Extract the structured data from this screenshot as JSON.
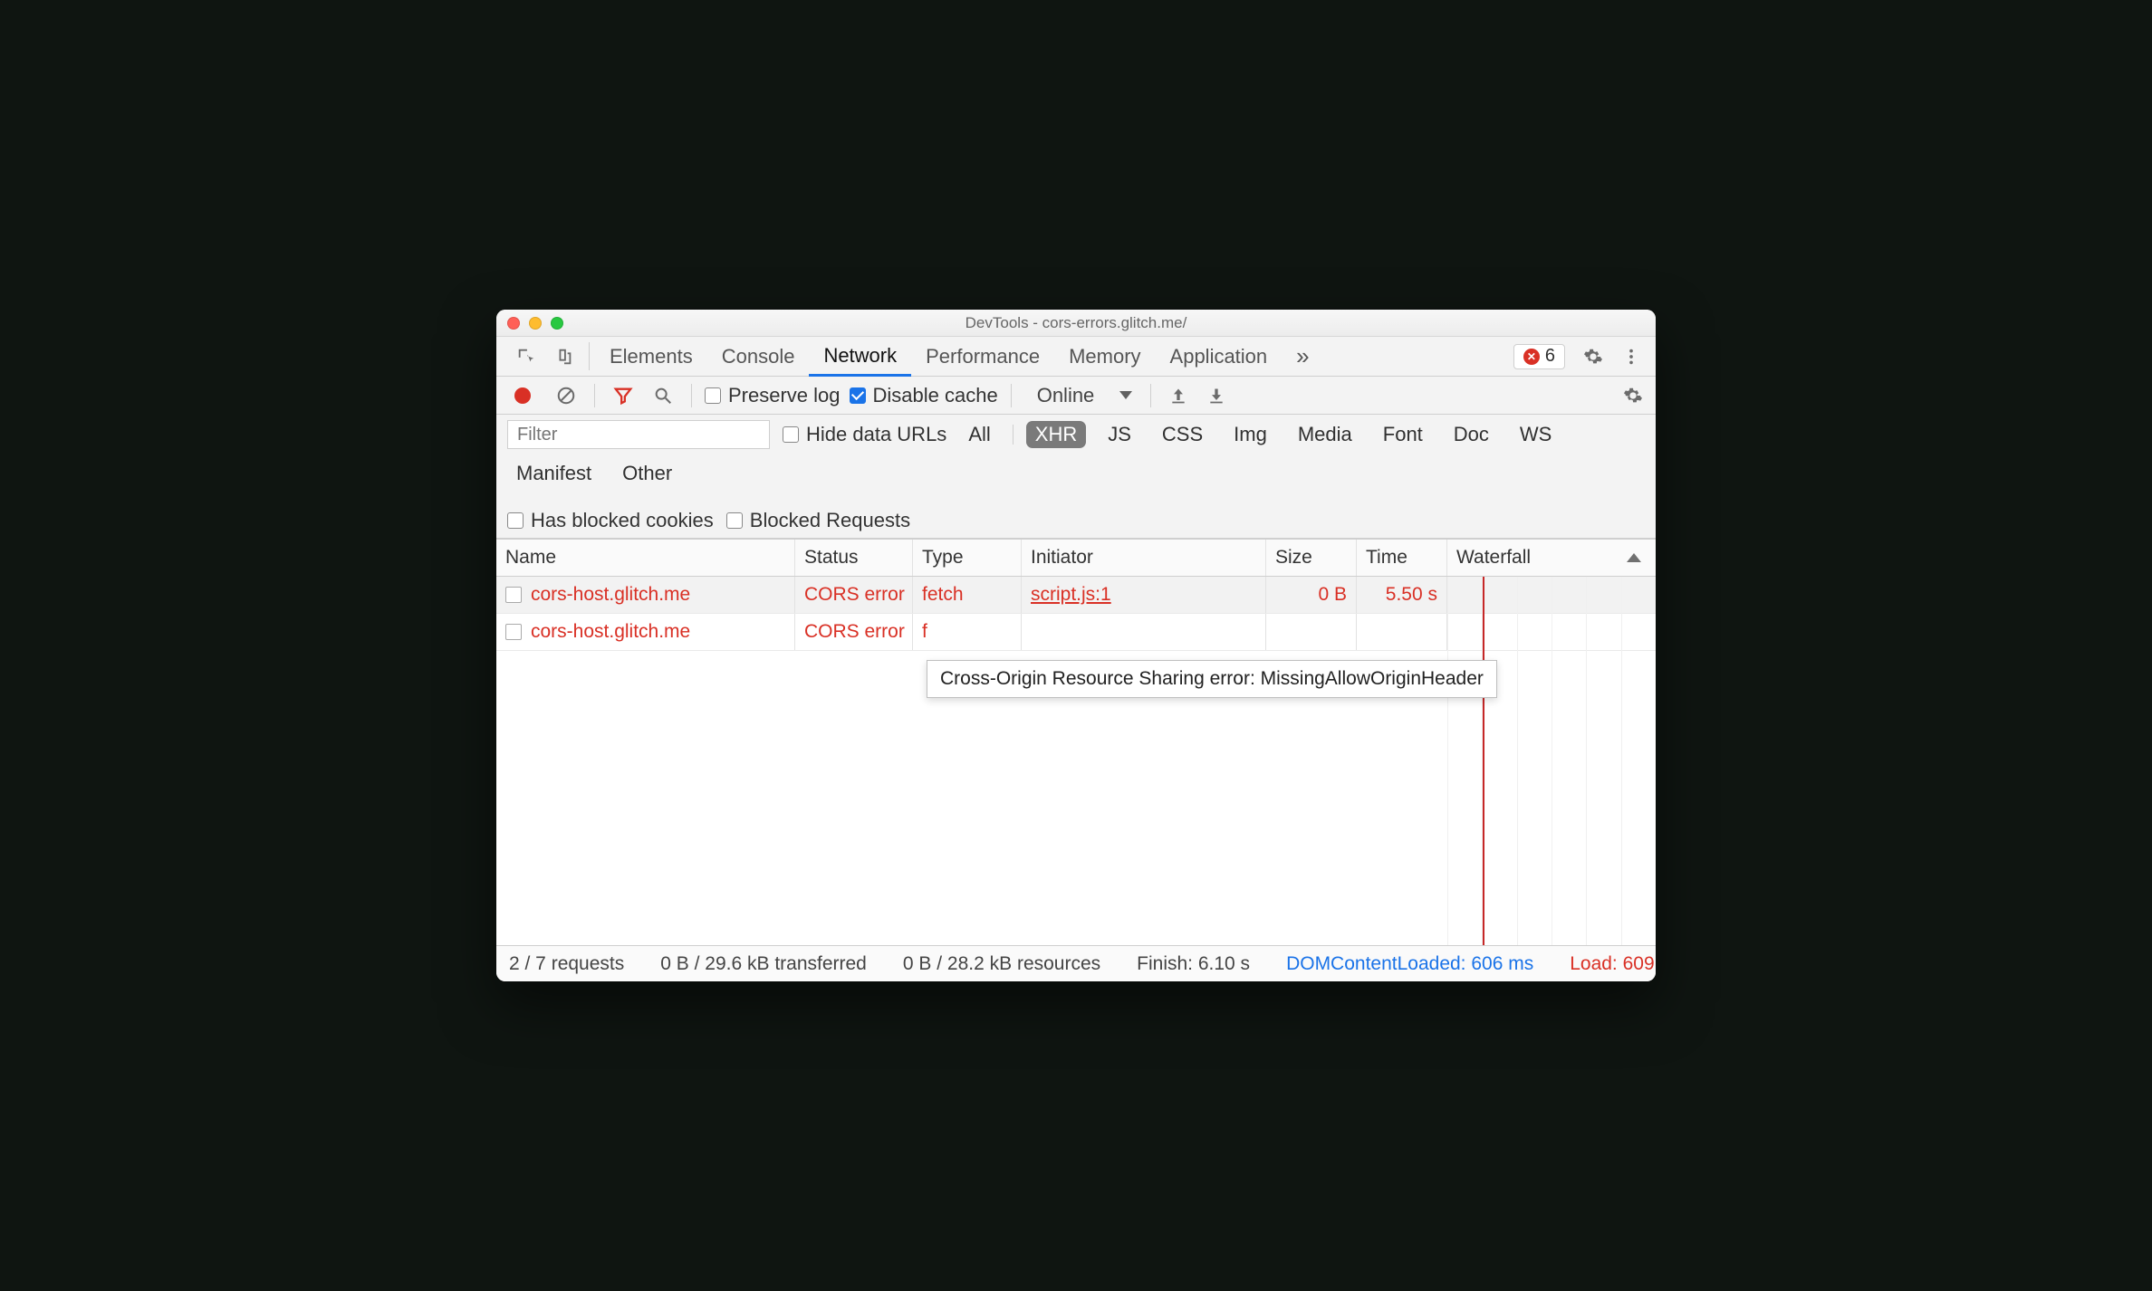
{
  "window": {
    "title": "DevTools - cors-errors.glitch.me/"
  },
  "error_badge": {
    "count": "6"
  },
  "tabs": {
    "items": [
      "Elements",
      "Console",
      "Network",
      "Performance",
      "Memory",
      "Application"
    ],
    "active_index": 2,
    "overflow_glyph": "»"
  },
  "toolbar": {
    "preserve_log": {
      "label": "Preserve log",
      "checked": false
    },
    "disable_cache": {
      "label": "Disable cache",
      "checked": true
    },
    "throttling": {
      "label": "Online"
    }
  },
  "filters": {
    "placeholder": "Filter",
    "hide_data_urls": {
      "label": "Hide data URLs",
      "checked": false
    },
    "types": [
      "All",
      "XHR",
      "JS",
      "CSS",
      "Img",
      "Media",
      "Font",
      "Doc",
      "WS",
      "Manifest",
      "Other"
    ],
    "active_type_index": 1,
    "has_blocked_cookies": {
      "label": "Has blocked cookies",
      "checked": false
    },
    "blocked_requests": {
      "label": "Blocked Requests",
      "checked": false
    }
  },
  "table": {
    "headers": {
      "name": "Name",
      "status": "Status",
      "type": "Type",
      "initiator": "Initiator",
      "size": "Size",
      "time": "Time",
      "waterfall": "Waterfall"
    },
    "rows": [
      {
        "name": "cors-host.glitch.me",
        "status": "CORS error",
        "type": "fetch",
        "initiator": "script.js:1",
        "size": "0 B",
        "time": "5.50 s",
        "selected": true
      },
      {
        "name": "cors-host.glitch.me",
        "status": "CORS error",
        "type": "f",
        "initiator": "",
        "size": "",
        "time": "",
        "selected": false
      }
    ],
    "tooltip": "Cross-Origin Resource Sharing error: MissingAllowOriginHeader"
  },
  "statusbar": {
    "requests": "2 / 7 requests",
    "transferred": "0 B / 29.6 kB transferred",
    "resources": "0 B / 28.2 kB resources",
    "finish": "Finish: 6.10 s",
    "dcl": "DOMContentLoaded: 606 ms",
    "load": "Load: 609"
  }
}
